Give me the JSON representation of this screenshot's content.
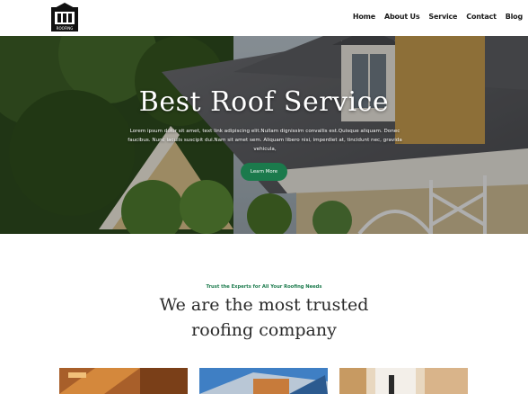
{
  "header": {
    "logo_text": "ROOFING",
    "nav": [
      {
        "label": "Home"
      },
      {
        "label": "About Us"
      },
      {
        "label": "Service"
      },
      {
        "label": "Contact"
      },
      {
        "label": "Blog"
      }
    ]
  },
  "hero": {
    "title": "Best  Roof Service",
    "text": "Lorem ipsum dolor sit amet, text link adipiscing elit.Nullam dignissim convallis est.Quisque aliquam. Donec faucibus. Nunc iaculis suscipit dui.Nam sit amet sem. Aliquam libero nisi, imperdiet at, tincidunt nec, gravida vehicula,",
    "button_label": "Learn More"
  },
  "section": {
    "kicker": "Trust the Experts for All Your Roofing Needs",
    "headline_line1": "We are the most trusted",
    "headline_line2": "roofing company"
  },
  "colors": {
    "accent": "#1b7a4c",
    "heading": "#2a2a2a",
    "nav_text": "#1a1a1a"
  }
}
